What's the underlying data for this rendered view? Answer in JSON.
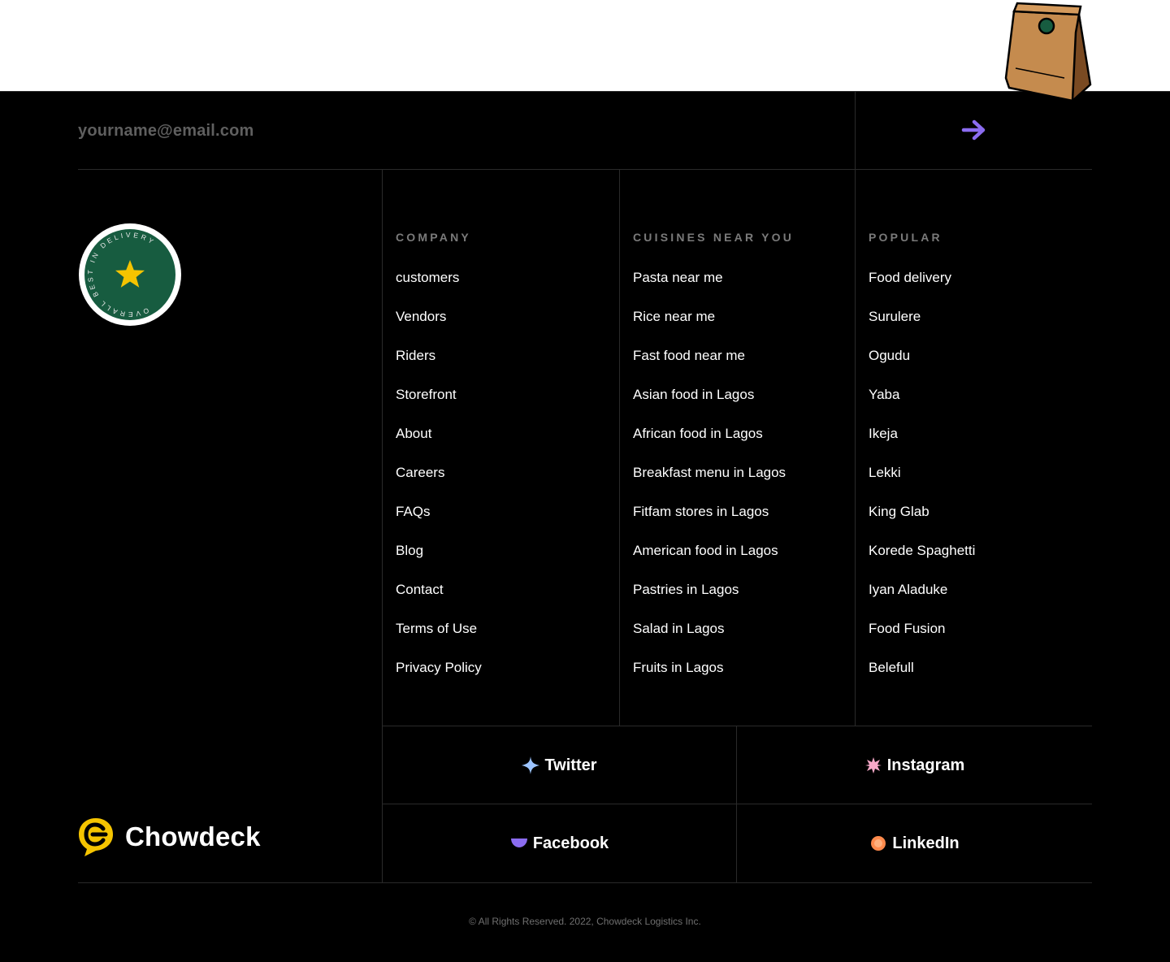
{
  "newsletter": {
    "email_placeholder": "yourname@email.com",
    "submit_icon": "arrow-right-icon",
    "accent_color": "#8b6cf0"
  },
  "badge": {
    "ring_text": "OVERALL BEST IN DELIVERY",
    "badge_color": "#175c40",
    "star_color": "#f5c400"
  },
  "columns": [
    {
      "heading": "COMPANY",
      "links": [
        "customers",
        "Vendors",
        "Riders",
        "Storefront",
        "About",
        "Careers",
        "FAQs",
        "Blog",
        "Contact",
        "Terms of Use",
        "Privacy Policy"
      ]
    },
    {
      "heading": "CUISINES NEAR YOU",
      "links": [
        "Pasta near me",
        "Rice near me",
        "Fast food near me",
        "Asian food in Lagos",
        "African food in Lagos",
        "Breakfast menu in Lagos",
        "Fitfam stores in Lagos",
        "American food in Lagos",
        "Pastries in Lagos",
        "Salad in Lagos",
        "Fruits in Lagos"
      ]
    },
    {
      "heading": "POPULAR",
      "links": [
        "Food delivery",
        "Surulere",
        "Ogudu",
        "Yaba",
        "Ikeja",
        "Lekki",
        "King Glab",
        "Korede Spaghetti",
        "Iyan Aladuke",
        "Food Fusion",
        "Belefull"
      ]
    }
  ],
  "social": [
    {
      "label": "Twitter",
      "icon": "sparkle-icon",
      "icon_color": "#9cc4ff"
    },
    {
      "label": "Instagram",
      "icon": "flower-icon",
      "icon_color": "#f7a8c8"
    },
    {
      "label": "Facebook",
      "icon": "half-circle-icon",
      "icon_color": "#8b6cf0"
    },
    {
      "label": "LinkedIn",
      "icon": "circle-icon",
      "icon_color": "#ff8a4c"
    }
  ],
  "brand": {
    "name": "Chowdeck",
    "logo_color": "#f5c400"
  },
  "copyright": "© All Rights Reserved. 2022, Chowdeck Logistics Inc."
}
